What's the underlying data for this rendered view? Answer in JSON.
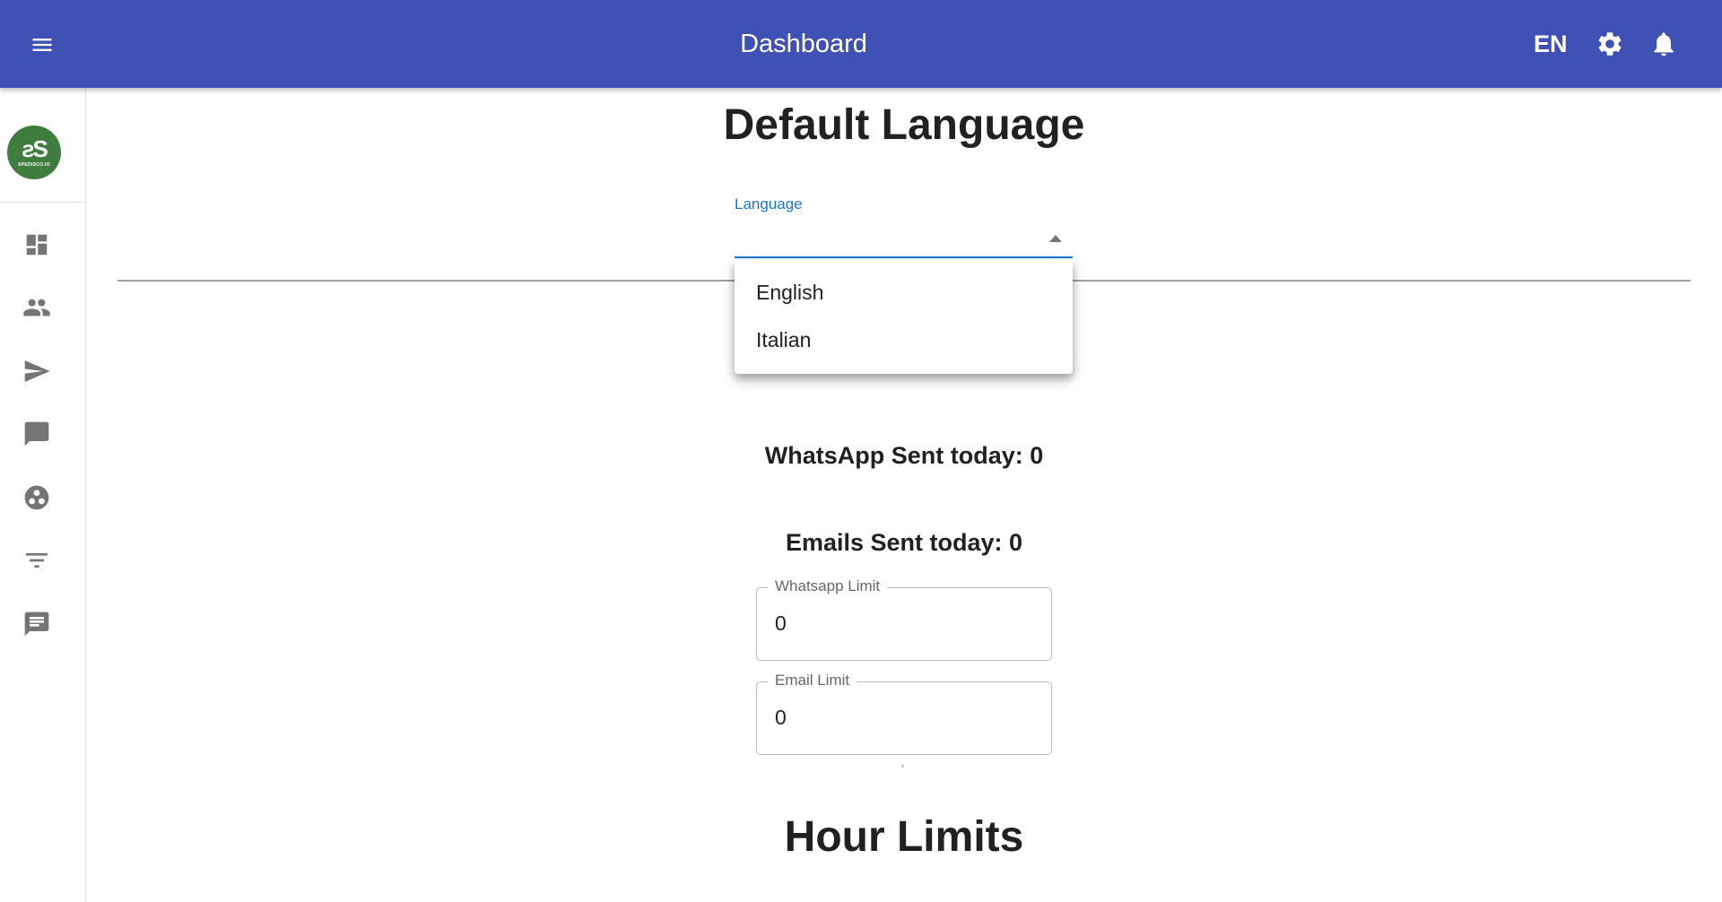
{
  "appbar": {
    "title": "Dashboard",
    "language": "EN",
    "icons": [
      "menu-icon",
      "settings-icon",
      "notifications-icon"
    ],
    "color": "#3f51b5"
  },
  "sidebar": {
    "logo": {
      "mark": "ƨS",
      "text": "SPEDISCO.IO",
      "color": "#3f7d3f"
    },
    "items": [
      {
        "icon": "dashboard-icon"
      },
      {
        "icon": "people-icon"
      },
      {
        "icon": "send-icon"
      },
      {
        "icon": "chat-bubble-icon"
      },
      {
        "icon": "workspaces-icon"
      },
      {
        "icon": "filter-list-icon"
      },
      {
        "icon": "message-icon"
      }
    ]
  },
  "main": {
    "default_language": {
      "heading": "Default Language",
      "label": "Language",
      "value": "",
      "options": [
        "English",
        "Italian"
      ],
      "accent": "#1976d2"
    },
    "limits": {
      "whatsapp_sent": "WhatsApp Sent today: 0",
      "emails_sent": "Emails Sent today: 0",
      "whatsapp_limit": {
        "label": "Whatsapp Limit",
        "value": "0"
      },
      "email_limit": {
        "label": "Email Limit",
        "value": "0"
      }
    },
    "hour_limits": {
      "heading": "Hour Limits"
    }
  }
}
